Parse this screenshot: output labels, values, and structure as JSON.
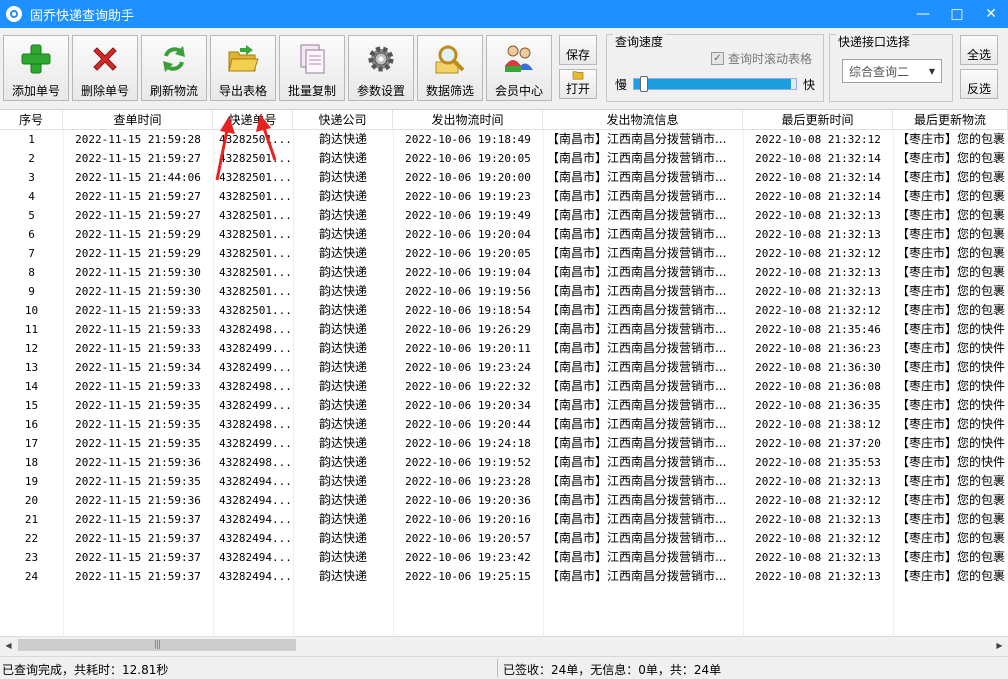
{
  "window": {
    "title": "固乔快递查询助手",
    "minimize": "—",
    "maximize": "□",
    "close": "✕"
  },
  "toolbar": {
    "add_label": "添加单号",
    "delete_label": "删除单号",
    "refresh_label": "刷新物流",
    "export_label": "导出表格",
    "batch_copy_label": "批量复制",
    "settings_label": "参数设置",
    "filter_label": "数据筛选",
    "member_label": "会员中心",
    "save_label": "保存",
    "open_label": "打开",
    "select_all_label": "全选",
    "invert_label": "反选"
  },
  "speed": {
    "title": "查询速度",
    "scroll_check_label": "查询时滚动表格",
    "scroll_checked": true,
    "slow_label": "慢",
    "fast_label": "快",
    "level": 0.97
  },
  "interface": {
    "title": "快递接口选择",
    "selected": "综合查询二"
  },
  "table": {
    "columns": [
      "序号",
      "查单时间",
      "快递单号",
      "快递公司",
      "发出物流时间",
      "发出物流信息",
      "最后更新时间",
      "最后更新物流"
    ],
    "rows": [
      [
        "1",
        "2022-11-15 21:59:28",
        "43282501...",
        "韵达快递",
        "2022-10-06 19:18:49",
        "【南昌市】江西南昌分拨营销市...",
        "2022-10-08 21:32:12",
        "【枣庄市】您的包裹"
      ],
      [
        "2",
        "2022-11-15 21:59:27",
        "43282501...",
        "韵达快递",
        "2022-10-06 19:20:05",
        "【南昌市】江西南昌分拨营销市...",
        "2022-10-08 21:32:14",
        "【枣庄市】您的包裹"
      ],
      [
        "3",
        "2022-11-15 21:44:06",
        "43282501...",
        "韵达快递",
        "2022-10-06 19:20:00",
        "【南昌市】江西南昌分拨营销市...",
        "2022-10-08 21:32:14",
        "【枣庄市】您的包裹"
      ],
      [
        "4",
        "2022-11-15 21:59:27",
        "43282501...",
        "韵达快递",
        "2022-10-06 19:19:23",
        "【南昌市】江西南昌分拨营销市...",
        "2022-10-08 21:32:14",
        "【枣庄市】您的包裹"
      ],
      [
        "5",
        "2022-11-15 21:59:27",
        "43282501...",
        "韵达快递",
        "2022-10-06 19:19:49",
        "【南昌市】江西南昌分拨营销市...",
        "2022-10-08 21:32:13",
        "【枣庄市】您的包裹"
      ],
      [
        "6",
        "2022-11-15 21:59:29",
        "43282501...",
        "韵达快递",
        "2022-10-06 19:20:04",
        "【南昌市】江西南昌分拨营销市...",
        "2022-10-08 21:32:13",
        "【枣庄市】您的包裹"
      ],
      [
        "7",
        "2022-11-15 21:59:29",
        "43282501...",
        "韵达快递",
        "2022-10-06 19:20:05",
        "【南昌市】江西南昌分拨营销市...",
        "2022-10-08 21:32:12",
        "【枣庄市】您的包裹"
      ],
      [
        "8",
        "2022-11-15 21:59:30",
        "43282501...",
        "韵达快递",
        "2022-10-06 19:19:04",
        "【南昌市】江西南昌分拨营销市...",
        "2022-10-08 21:32:13",
        "【枣庄市】您的包裹"
      ],
      [
        "9",
        "2022-11-15 21:59:30",
        "43282501...",
        "韵达快递",
        "2022-10-06 19:19:56",
        "【南昌市】江西南昌分拨营销市...",
        "2022-10-08 21:32:13",
        "【枣庄市】您的包裹"
      ],
      [
        "10",
        "2022-11-15 21:59:33",
        "43282501...",
        "韵达快递",
        "2022-10-06 19:18:54",
        "【南昌市】江西南昌分拨营销市...",
        "2022-10-08 21:32:12",
        "【枣庄市】您的包裹"
      ],
      [
        "11",
        "2022-11-15 21:59:33",
        "43282498...",
        "韵达快递",
        "2022-10-06 19:26:29",
        "【南昌市】江西南昌分拨营销市...",
        "2022-10-08 21:35:46",
        "【枣庄市】您的快件"
      ],
      [
        "12",
        "2022-11-15 21:59:33",
        "43282499...",
        "韵达快递",
        "2022-10-06 19:20:11",
        "【南昌市】江西南昌分拨营销市...",
        "2022-10-08 21:36:23",
        "【枣庄市】您的快件"
      ],
      [
        "13",
        "2022-11-15 21:59:34",
        "43282499...",
        "韵达快递",
        "2022-10-06 19:23:24",
        "【南昌市】江西南昌分拨营销市...",
        "2022-10-08 21:36:30",
        "【枣庄市】您的快件"
      ],
      [
        "14",
        "2022-11-15 21:59:33",
        "43282498...",
        "韵达快递",
        "2022-10-06 19:22:32",
        "【南昌市】江西南昌分拨营销市...",
        "2022-10-08 21:36:08",
        "【枣庄市】您的快件"
      ],
      [
        "15",
        "2022-11-15 21:59:35",
        "43282499...",
        "韵达快递",
        "2022-10-06 19:20:34",
        "【南昌市】江西南昌分拨营销市...",
        "2022-10-08 21:36:35",
        "【枣庄市】您的快件"
      ],
      [
        "16",
        "2022-11-15 21:59:35",
        "43282498...",
        "韵达快递",
        "2022-10-06 19:20:44",
        "【南昌市】江西南昌分拨营销市...",
        "2022-10-08 21:38:12",
        "【枣庄市】您的快件"
      ],
      [
        "17",
        "2022-11-15 21:59:35",
        "43282499...",
        "韵达快递",
        "2022-10-06 19:24:18",
        "【南昌市】江西南昌分拨营销市...",
        "2022-10-08 21:37:20",
        "【枣庄市】您的快件"
      ],
      [
        "18",
        "2022-11-15 21:59:36",
        "43282498...",
        "韵达快递",
        "2022-10-06 19:19:52",
        "【南昌市】江西南昌分拨营销市...",
        "2022-10-08 21:35:53",
        "【枣庄市】您的快件"
      ],
      [
        "19",
        "2022-11-15 21:59:35",
        "43282494...",
        "韵达快递",
        "2022-10-06 19:23:28",
        "【南昌市】江西南昌分拨营销市...",
        "2022-10-08 21:32:13",
        "【枣庄市】您的包裹"
      ],
      [
        "20",
        "2022-11-15 21:59:36",
        "43282494...",
        "韵达快递",
        "2022-10-06 19:20:36",
        "【南昌市】江西南昌分拨营销市...",
        "2022-10-08 21:32:12",
        "【枣庄市】您的包裹"
      ],
      [
        "21",
        "2022-11-15 21:59:37",
        "43282494...",
        "韵达快递",
        "2022-10-06 19:20:16",
        "【南昌市】江西南昌分拨营销市...",
        "2022-10-08 21:32:13",
        "【枣庄市】您的包裹"
      ],
      [
        "22",
        "2022-11-15 21:59:37",
        "43282494...",
        "韵达快递",
        "2022-10-06 19:20:57",
        "【南昌市】江西南昌分拨营销市...",
        "2022-10-08 21:32:12",
        "【枣庄市】您的包裹"
      ],
      [
        "23",
        "2022-11-15 21:59:37",
        "43282494...",
        "韵达快递",
        "2022-10-06 19:23:42",
        "【南昌市】江西南昌分拨营销市...",
        "2022-10-08 21:32:13",
        "【枣庄市】您的包裹"
      ],
      [
        "24",
        "2022-11-15 21:59:37",
        "43282494...",
        "韵达快递",
        "2022-10-06 19:25:15",
        "【南昌市】江西南昌分拨营销市...",
        "2022-10-08 21:32:13",
        "【枣庄市】您的包裹"
      ]
    ]
  },
  "scrollbar": {
    "left_arrow": "◀",
    "right_arrow": "▶",
    "grip": "|||"
  },
  "status": {
    "left": "已查询完成，共耗时：12.81秒",
    "right": "已签收：24单，无信息：0单，共：24单"
  },
  "colors": {
    "titlebar": "#1e90ff",
    "annotation_arrow": "#e8231f",
    "speed_fill": "#1aa0e0"
  }
}
